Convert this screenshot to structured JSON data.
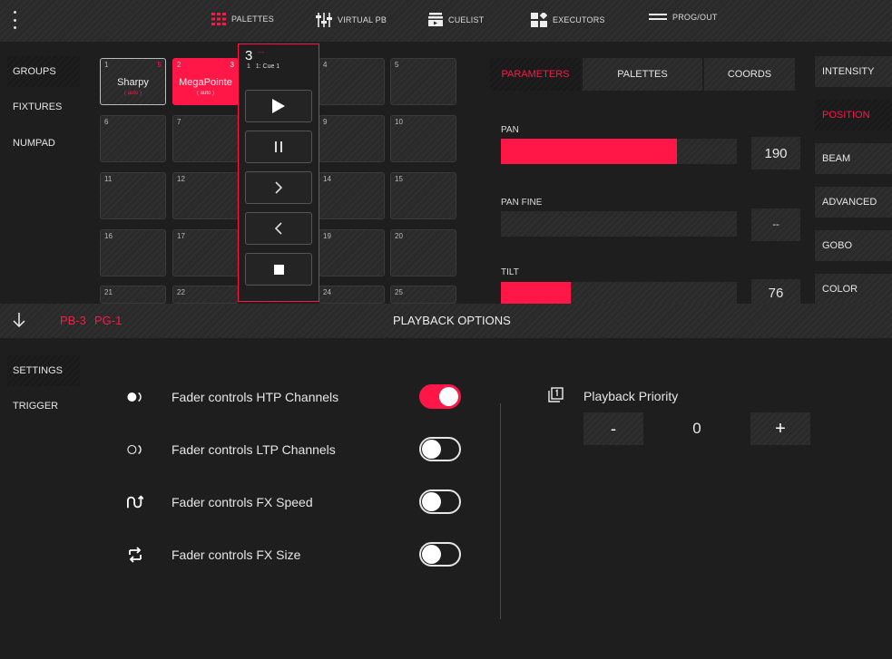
{
  "topbar": {
    "nav": [
      {
        "label": "PALETTES",
        "icon": "palette-grid-icon"
      },
      {
        "label": "VIRTUAL PB",
        "icon": "faders-icon"
      },
      {
        "label": "CUELIST",
        "icon": "cuelist-icon"
      },
      {
        "label": "EXECUTORS",
        "icon": "executors-icon"
      },
      {
        "label": "PROG/OUT",
        "icon": "prog-out-icon"
      }
    ]
  },
  "left_nav": [
    {
      "label": "GROUPS",
      "active": true
    },
    {
      "label": "FIXTURES",
      "active": false
    },
    {
      "label": "NUMPAD",
      "active": false
    }
  ],
  "groups": {
    "cells": [
      {
        "num": "1",
        "name": "Sharpy",
        "sub": "( auto )",
        "badge": "5"
      },
      {
        "num": "2",
        "name": "MegaPointe",
        "sub": "( auto )",
        "badge": "3"
      },
      {
        "num": "4"
      },
      {
        "num": "5"
      },
      {
        "num": "6"
      },
      {
        "num": "7"
      },
      {
        "num": "9"
      },
      {
        "num": "10"
      },
      {
        "num": "11"
      },
      {
        "num": "12"
      },
      {
        "num": "14"
      },
      {
        "num": "15"
      },
      {
        "num": "16"
      },
      {
        "num": "17"
      },
      {
        "num": "19"
      },
      {
        "num": "20"
      },
      {
        "num": "21"
      },
      {
        "num": "22"
      },
      {
        "num": "24"
      },
      {
        "num": "25"
      }
    ]
  },
  "playback_popup": {
    "number": "3",
    "dash": "---",
    "cue": "1   1: Cue 1",
    "buttons": [
      "play-icon",
      "pause-icon",
      "next-icon",
      "previous-icon",
      "stop-icon"
    ]
  },
  "param_tabs": [
    {
      "label": "PARAMETERS",
      "active": true
    },
    {
      "label": "PALETTES",
      "active": false
    },
    {
      "label": "COORDS",
      "active": false
    }
  ],
  "params": [
    {
      "label": "PAN",
      "value": "190",
      "fill": 0.745
    },
    {
      "label": "PAN FINE",
      "value": "--",
      "fill": 0
    },
    {
      "label": "TILT",
      "value": "76",
      "fill": 0.298
    }
  ],
  "right_nav": [
    {
      "label": "INTENSITY",
      "active": false
    },
    {
      "label": "POSITION",
      "active": true
    },
    {
      "label": "BEAM",
      "active": false
    },
    {
      "label": "ADVANCED",
      "active": false
    },
    {
      "label": "GOBO",
      "active": false
    },
    {
      "label": "COLOR",
      "active": false
    }
  ],
  "section_bar": {
    "pb": "PB-3",
    "pg": "PG-1",
    "title": "PLAYBACK OPTIONS"
  },
  "options_nav": [
    {
      "label": "SETTINGS",
      "active": true
    },
    {
      "label": "TRIGGER",
      "active": false
    }
  ],
  "options": [
    {
      "label": "Fader controls HTP Channels",
      "on": true,
      "icon": "htp-icon"
    },
    {
      "label": "Fader controls LTP Channels",
      "on": false,
      "icon": "ltp-icon"
    },
    {
      "label": "Fader controls FX Speed",
      "on": false,
      "icon": "fx-speed-icon"
    },
    {
      "label": "Fader controls FX Size",
      "on": false,
      "icon": "fx-size-icon"
    }
  ],
  "priority": {
    "label": "Playback Priority",
    "minus": "-",
    "value": "0",
    "plus": "+"
  },
  "colors": {
    "accent": "#ff1747",
    "background": "#1e1e1e"
  }
}
